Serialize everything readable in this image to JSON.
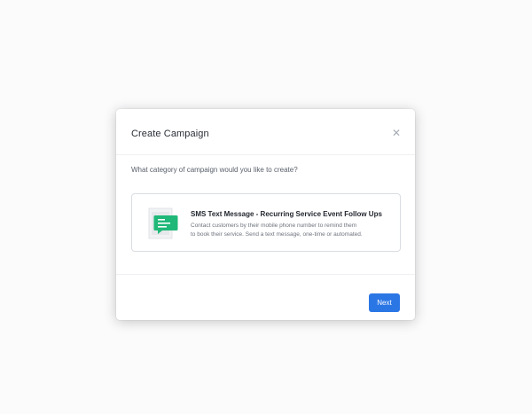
{
  "modal": {
    "title": "Create Campaign",
    "close_icon": "close-icon",
    "question": "What category of campaign would you like to create?",
    "options": [
      {
        "icon": "sms-message-illustration",
        "title": "SMS Text Message - Recurring Service Event Follow Ups",
        "description_line1": "Contact customers by their mobile phone number to remind them",
        "description_line2": "to book their service. Send a text message, one-time or automated."
      }
    ],
    "next_label": "Next"
  },
  "colors": {
    "accent": "#2b76e5",
    "sms_green": "#1fb878"
  }
}
